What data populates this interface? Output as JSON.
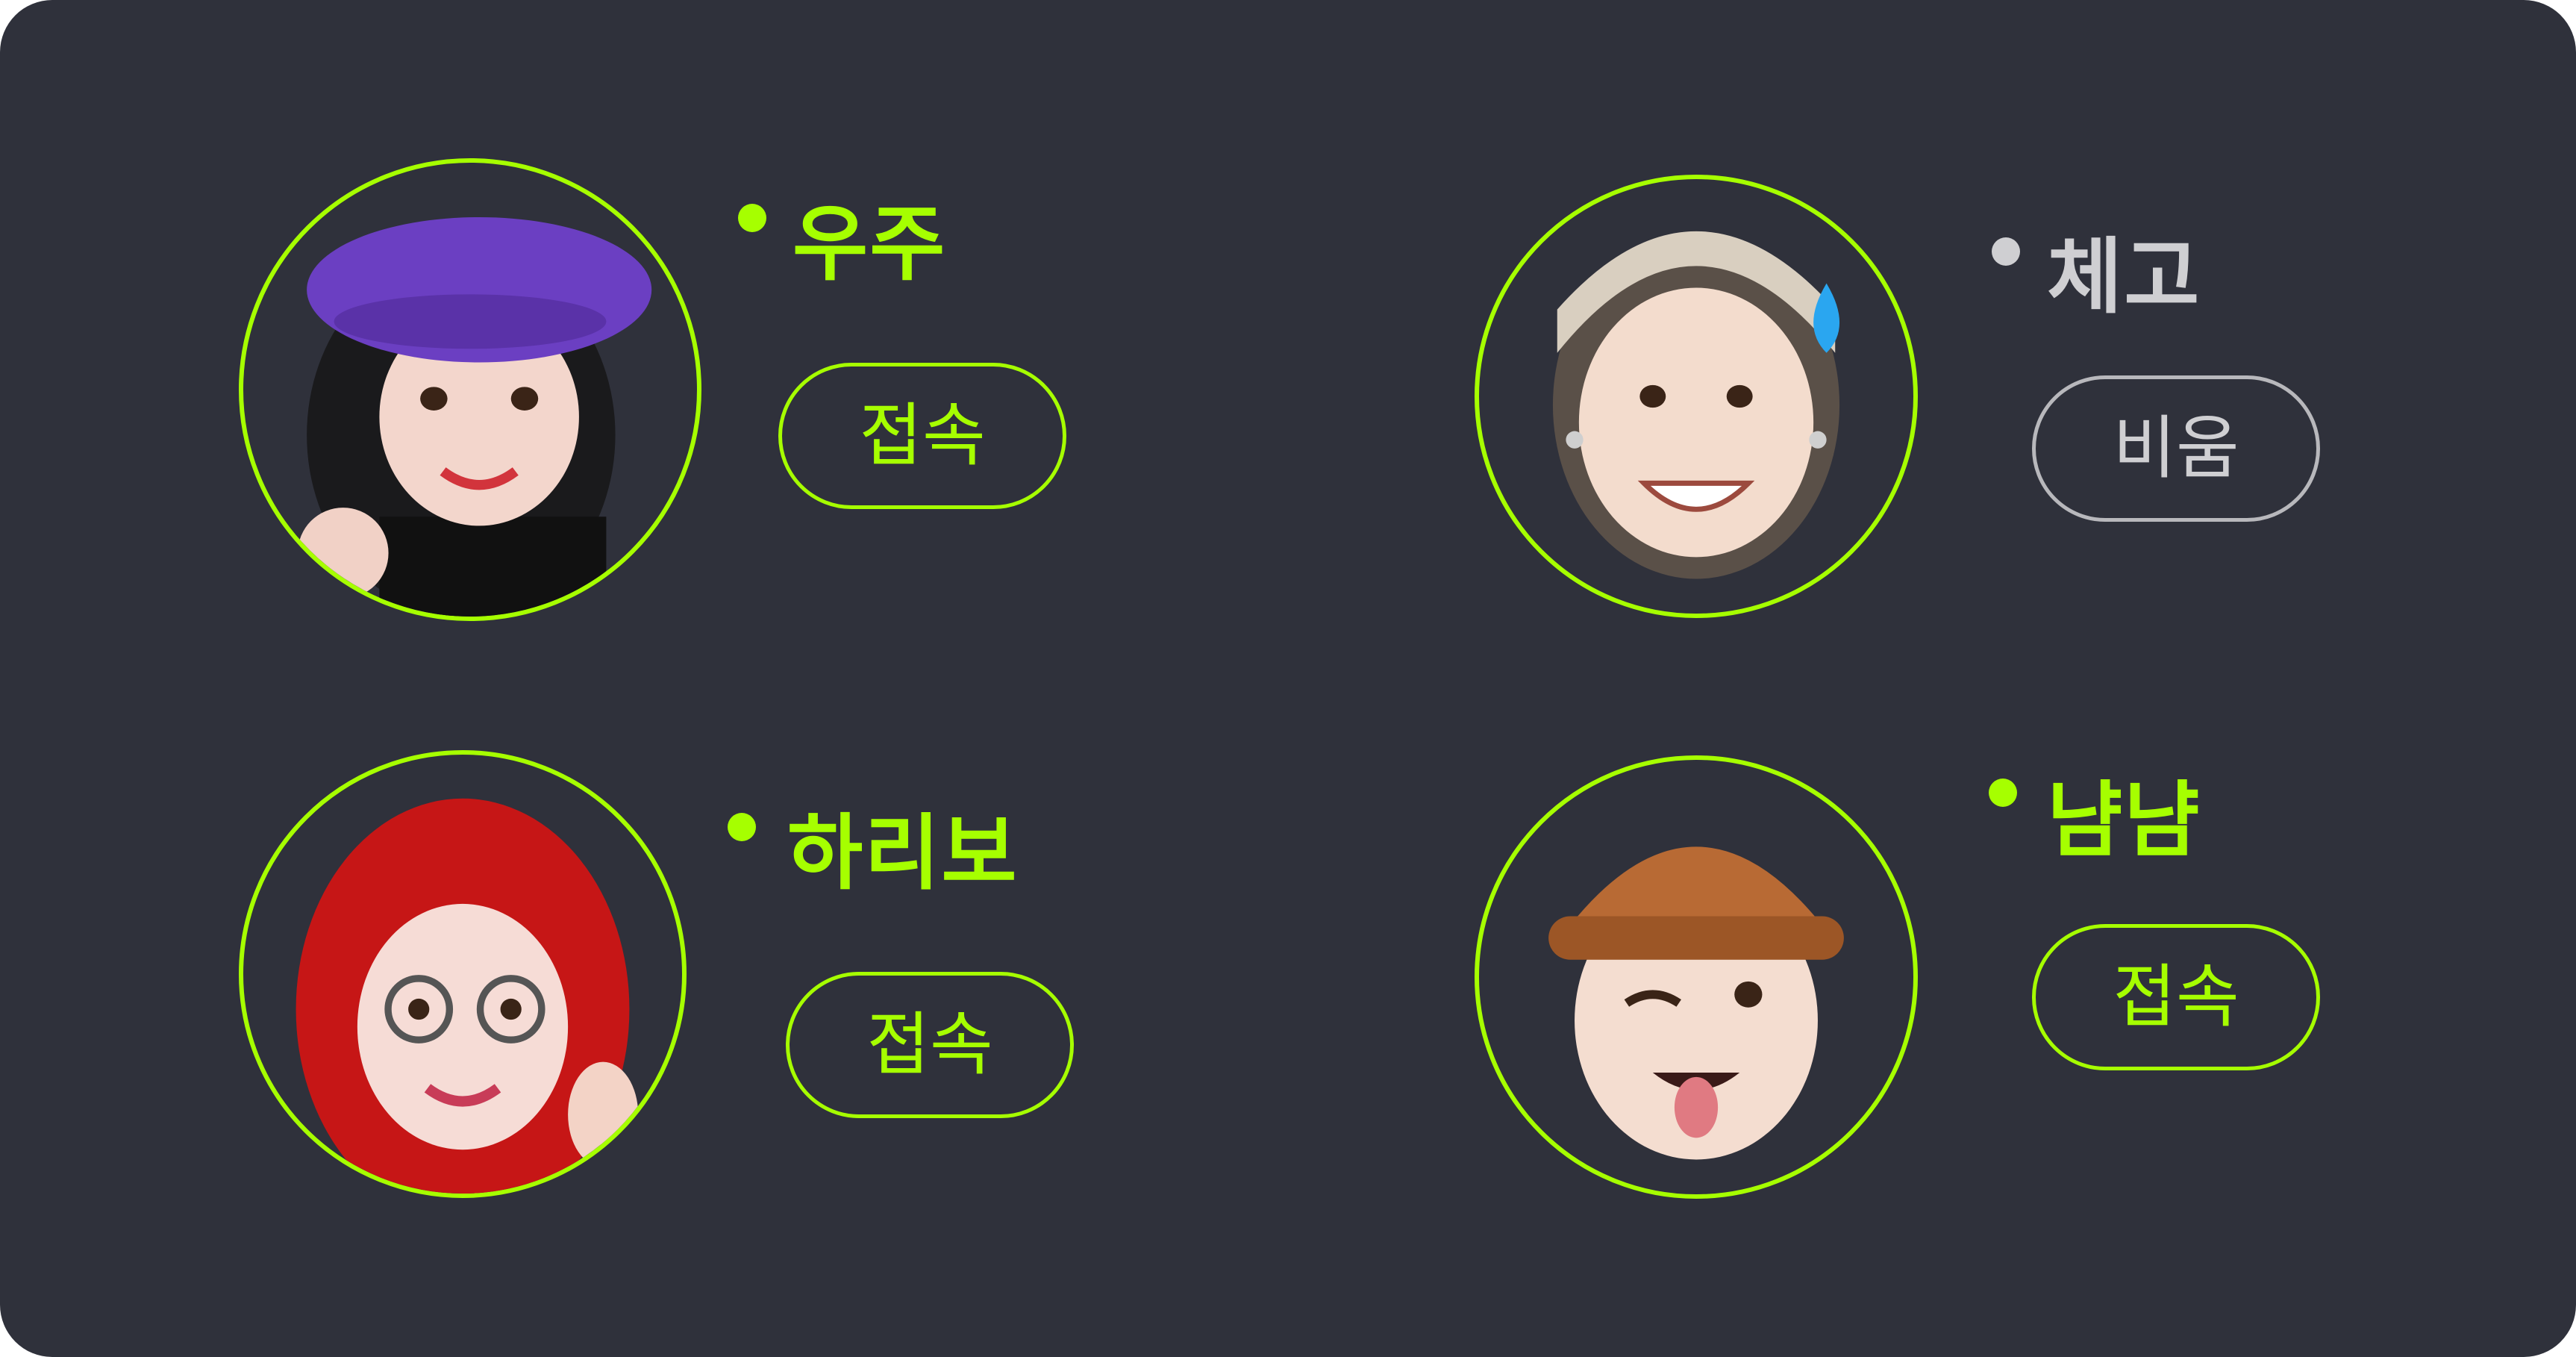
{
  "colors": {
    "background": "#2f313b",
    "online": "#a6ff00",
    "away": "#cfcfd2"
  },
  "members": [
    {
      "name": "우주",
      "status": "접속",
      "state": "online",
      "avatar_icon": "memoji-purple-beret-avatar"
    },
    {
      "name": "체고",
      "status": "비움",
      "state": "away",
      "avatar_icon": "memoji-slicked-hair-sweat-avatar"
    },
    {
      "name": "하리보",
      "status": "접속",
      "state": "online",
      "avatar_icon": "memoji-red-hair-glasses-avatar"
    },
    {
      "name": "냠냠",
      "status": "접속",
      "state": "online",
      "avatar_icon": "memoji-brown-beanie-wink-avatar"
    }
  ]
}
